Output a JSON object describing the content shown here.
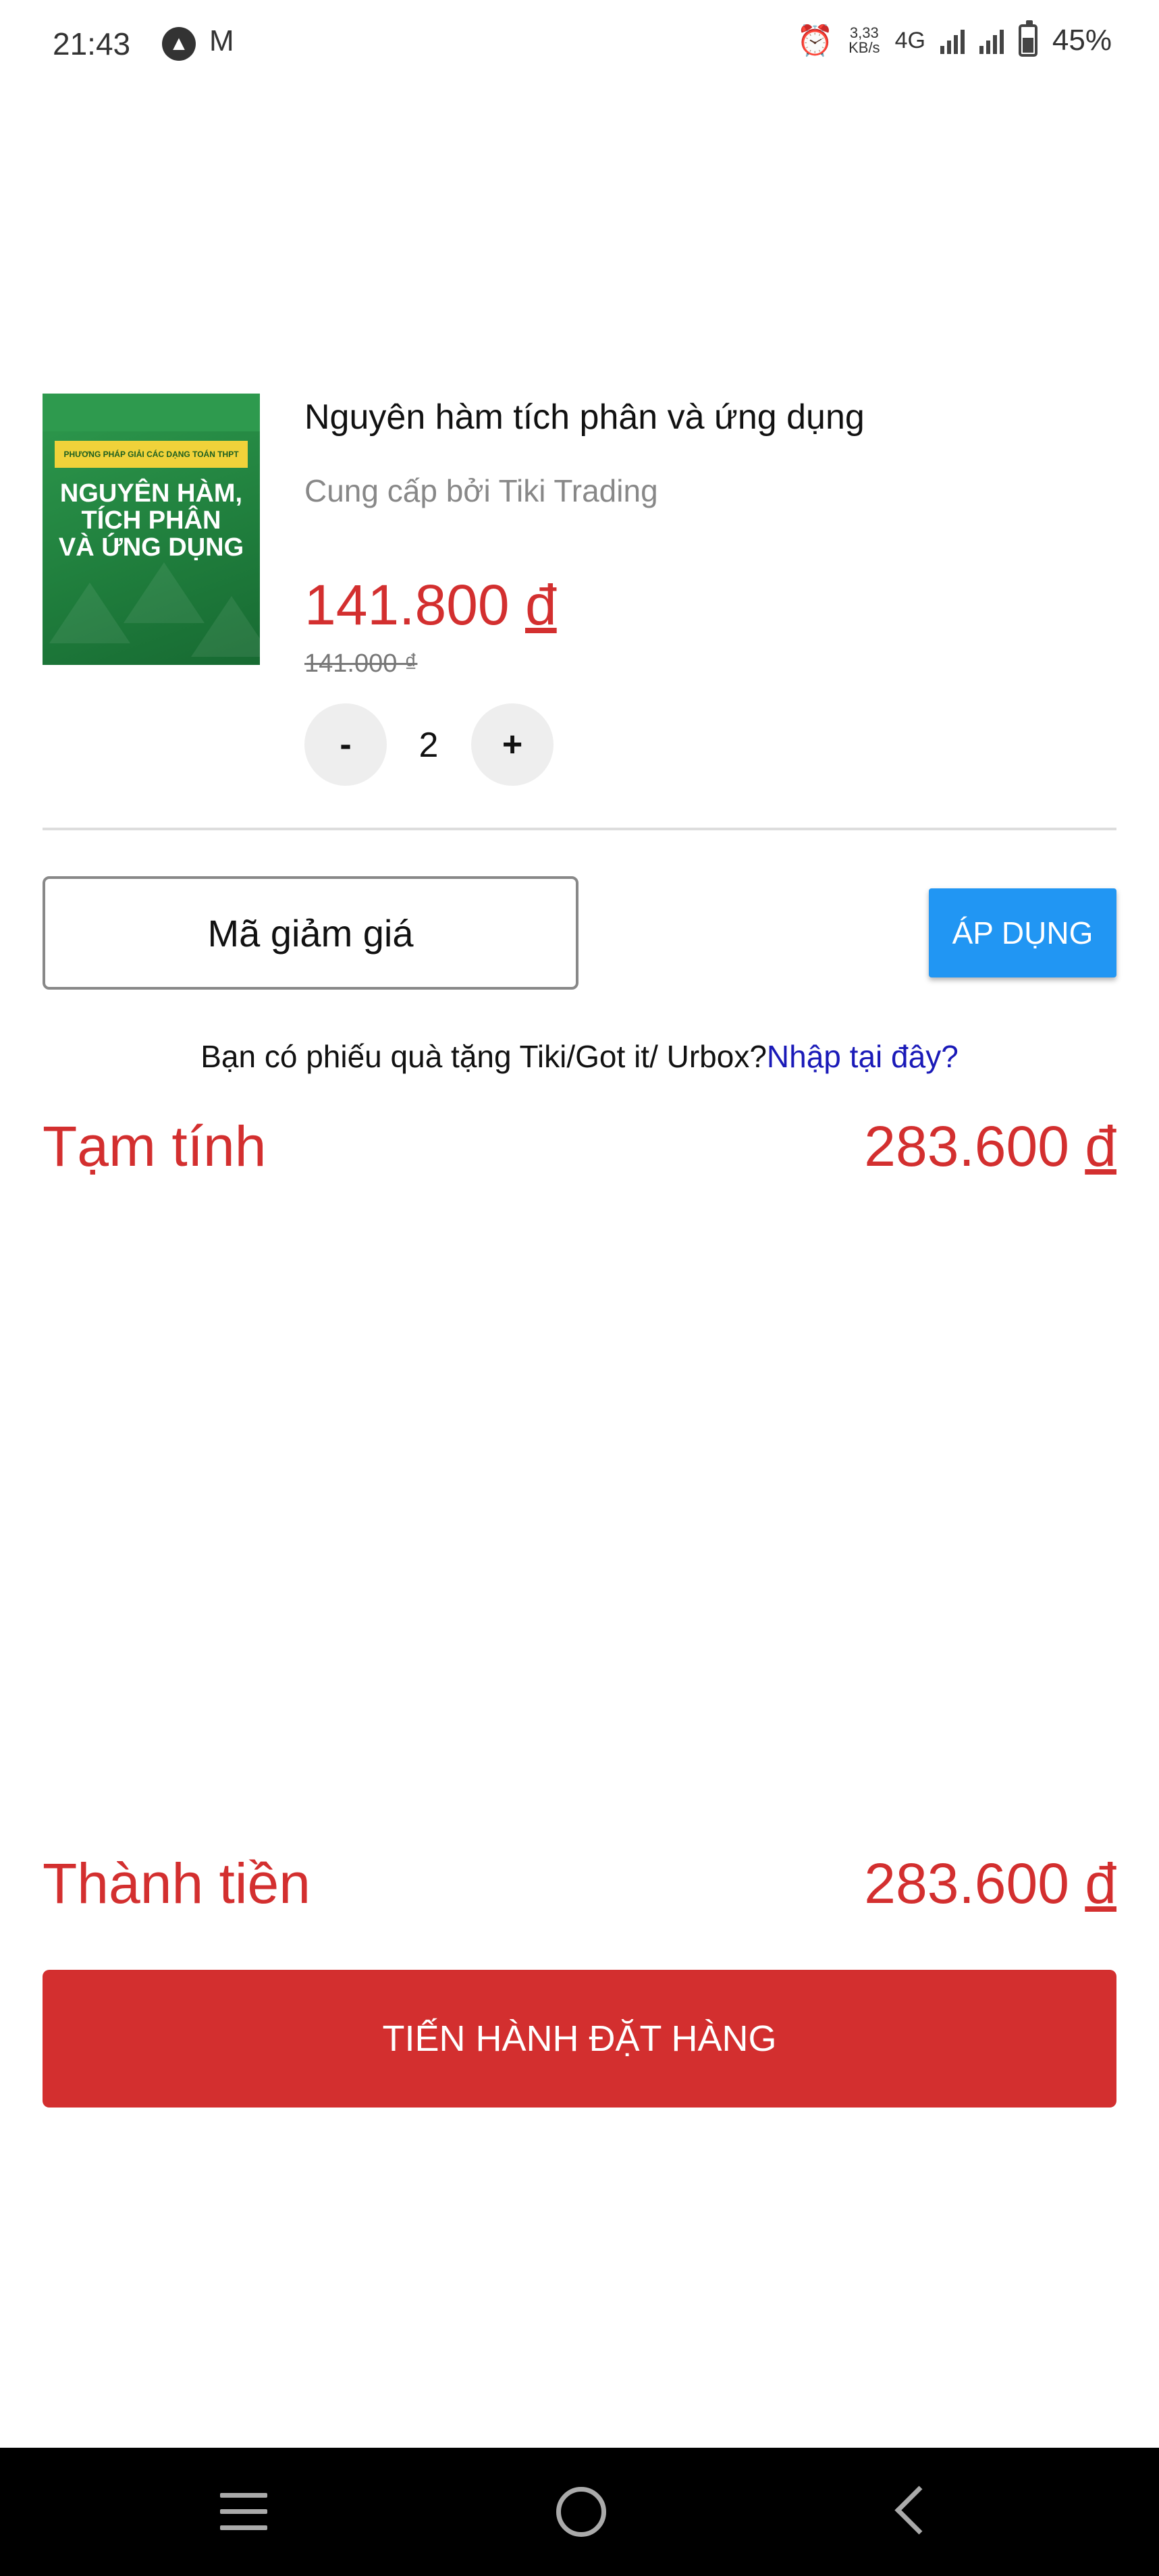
{
  "status_bar": {
    "time": "21:43",
    "notif_icons": [
      "assistant-icon",
      "gmail-icon"
    ],
    "net_speed": "3,33",
    "net_unit": "KB/s",
    "network": "4G",
    "battery": "45%"
  },
  "product": {
    "title": "Nguyên hàm tích phân và ứng dụng",
    "provider": "Cung cấp bởi Tiki Trading",
    "price": "141.800",
    "old_price": "141.000 ₫",
    "quantity": "2",
    "minus_label": "-",
    "plus_label": "+",
    "cover": {
      "series": "PHƯƠNG PHÁP GIẢI CÁC DẠNG TOÁN THPT",
      "title_lines": [
        "NGUYÊN HÀM,",
        "TÍCH PHÂN",
        "VÀ ỨNG DỤNG"
      ]
    }
  },
  "coupon": {
    "placeholder": "Mã giảm giá",
    "apply_label": "ÁP DỤNG"
  },
  "gift": {
    "question": "Bạn có phiếu quà tặng Tiki/Got it/ Urbox?",
    "link": "Nhập tại đây?"
  },
  "summary": {
    "subtotal_label": "Tạm tính",
    "subtotal_value": "283.600",
    "total_label": "Thành tiền",
    "total_value": "283.600",
    "currency": "đ"
  },
  "checkout": {
    "label": "TIẾN HÀNH ĐẶT HÀNG"
  },
  "colors": {
    "price_red": "#d32f2f",
    "apply_blue": "#2196f3",
    "link_blue": "#1a1ab8"
  }
}
